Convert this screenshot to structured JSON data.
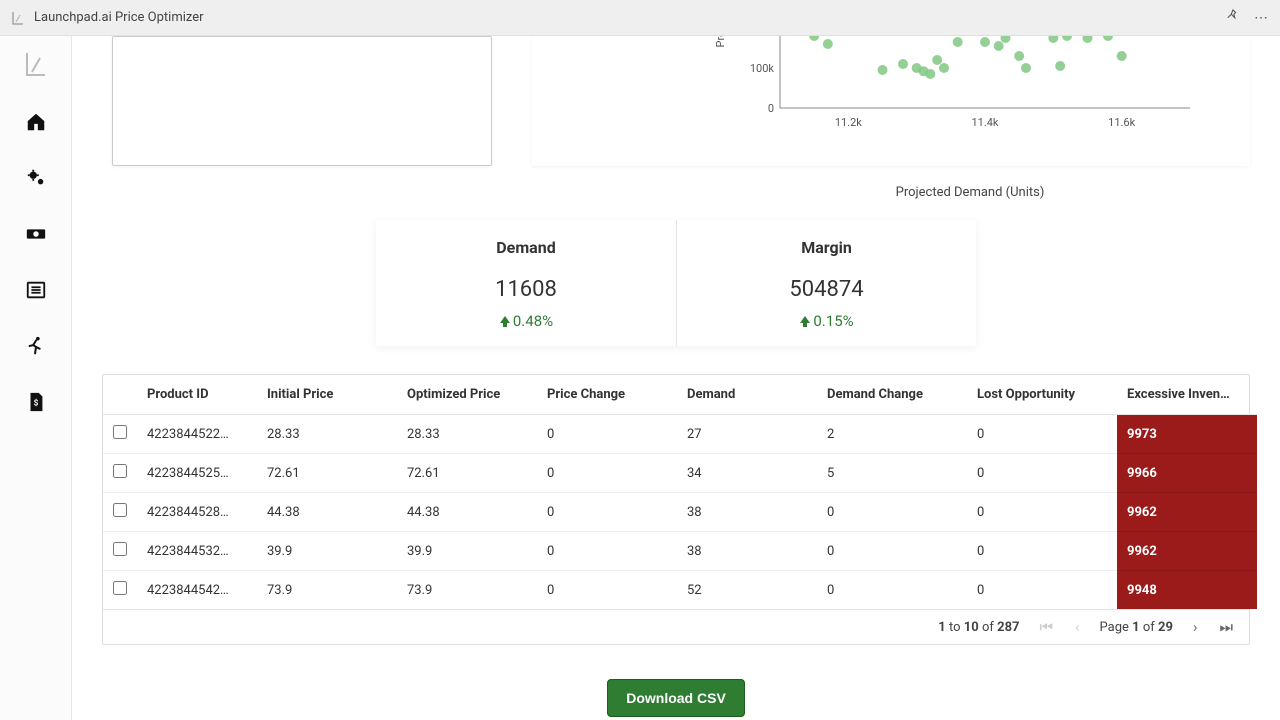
{
  "app": {
    "title": "Launchpad.ai Price Optimizer"
  },
  "topbar": {
    "pin_icon": "pin",
    "more_icon": "more"
  },
  "sidebar": {
    "items": [
      "logo",
      "home",
      "settings",
      "cash",
      "list",
      "run",
      "invoice"
    ]
  },
  "charts": {
    "scatter": {
      "ylabel_partial": "Proj",
      "xlabel": "Projected Demand (Units)",
      "ytick": "100k",
      "xticks": [
        "11.2k",
        "11.4k",
        "11.6k"
      ]
    }
  },
  "chart_data": {
    "type": "scatter",
    "title": "",
    "xlabel": "Projected Demand (Units)",
    "ylabel": "Proj…",
    "x_range": [
      11100,
      11700
    ],
    "y_range": [
      0,
      200000
    ],
    "yticks": [
      0,
      100000
    ],
    "xticks": [
      11200,
      11400,
      11600
    ],
    "points": [
      {
        "x": 11150,
        "y": 180000
      },
      {
        "x": 11170,
        "y": 160000
      },
      {
        "x": 11250,
        "y": 95000
      },
      {
        "x": 11280,
        "y": 110000
      },
      {
        "x": 11300,
        "y": 100000
      },
      {
        "x": 11310,
        "y": 92000
      },
      {
        "x": 11320,
        "y": 85000
      },
      {
        "x": 11330,
        "y": 120000
      },
      {
        "x": 11340,
        "y": 100000
      },
      {
        "x": 11360,
        "y": 165000
      },
      {
        "x": 11400,
        "y": 165000
      },
      {
        "x": 11420,
        "y": 155000
      },
      {
        "x": 11430,
        "y": 175000
      },
      {
        "x": 11450,
        "y": 130000
      },
      {
        "x": 11460,
        "y": 100000
      },
      {
        "x": 11500,
        "y": 175000
      },
      {
        "x": 11520,
        "y": 180000
      },
      {
        "x": 11550,
        "y": 175000
      },
      {
        "x": 11580,
        "y": 180000
      },
      {
        "x": 11600,
        "y": 130000
      },
      {
        "x": 11510,
        "y": 105000
      }
    ]
  },
  "metrics": {
    "demand": {
      "title": "Demand",
      "value": "11608",
      "delta": "0.48%"
    },
    "margin": {
      "title": "Margin",
      "value": "504874",
      "delta": "0.15%"
    }
  },
  "table": {
    "columns": [
      "Product ID",
      "Initial Price",
      "Optimized Price",
      "Price Change",
      "Demand",
      "Demand Change",
      "Lost Opportunity",
      "Excessive Inven…"
    ],
    "rows": [
      {
        "product_id": "4223844522…",
        "initial_price": "28.33",
        "optimized_price": "28.33",
        "price_change": "0",
        "demand": "27",
        "demand_change": "2",
        "lost_opportunity": "0",
        "excessive": "9973"
      },
      {
        "product_id": "4223844525…",
        "initial_price": "72.61",
        "optimized_price": "72.61",
        "price_change": "0",
        "demand": "34",
        "demand_change": "5",
        "lost_opportunity": "0",
        "excessive": "9966"
      },
      {
        "product_id": "4223844528…",
        "initial_price": "44.38",
        "optimized_price": "44.38",
        "price_change": "0",
        "demand": "38",
        "demand_change": "0",
        "lost_opportunity": "0",
        "excessive": "9962"
      },
      {
        "product_id": "4223844532…",
        "initial_price": "39.9",
        "optimized_price": "39.9",
        "price_change": "0",
        "demand": "38",
        "demand_change": "0",
        "lost_opportunity": "0",
        "excessive": "9962"
      },
      {
        "product_id": "4223844542…",
        "initial_price": "73.9",
        "optimized_price": "73.9",
        "price_change": "0",
        "demand": "52",
        "demand_change": "0",
        "lost_opportunity": "0",
        "excessive": "9948"
      }
    ],
    "footer": {
      "range_from": "1",
      "range_to": "10",
      "range_total": "287",
      "range_word_to": "to",
      "range_word_of": "of",
      "page_label": "Page",
      "page_current": "1",
      "page_of": "of",
      "page_total": "29"
    }
  },
  "download": {
    "label": "Download CSV"
  }
}
